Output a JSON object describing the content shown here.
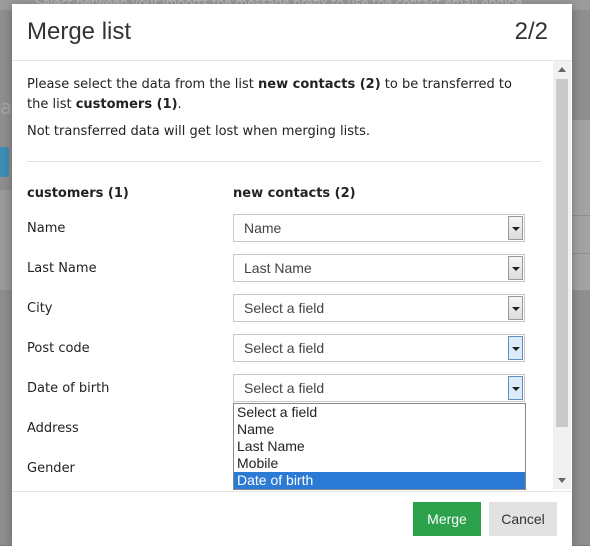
{
  "background": {
    "top_text": "Select between your imports the message prefix to use the contact email engine",
    "left_heading": "ag"
  },
  "modal": {
    "title": "Merge list",
    "step": "2/2",
    "intro_prefix": "Please select the data from the list ",
    "intro_source": "new contacts (2)",
    "intro_middle": " to be transferred to the list ",
    "intro_target": "customers (1)",
    "intro_suffix": ".",
    "note": "Not transferred data will get lost when merging lists.",
    "left_column_header": "customers (1)",
    "right_column_header": "new contacts (2)",
    "rows": [
      {
        "label": "Name",
        "value": "Name"
      },
      {
        "label": "Last Name",
        "value": "Last Name"
      },
      {
        "label": "City",
        "value": "Select a field"
      },
      {
        "label": "Post code",
        "value": "Select a field"
      },
      {
        "label": "Date of birth",
        "value": "Select a field"
      },
      {
        "label": "Address"
      },
      {
        "label": "Gender"
      }
    ],
    "dropdown_options": [
      "Select a field",
      "Name",
      "Last Name",
      "Mobile",
      "Date of birth"
    ],
    "dropdown_highlighted": "Date of birth",
    "merge_label": "Merge",
    "cancel_label": "Cancel",
    "accent_color": "#2aa14a",
    "highlight_color": "#2a7ad6"
  }
}
